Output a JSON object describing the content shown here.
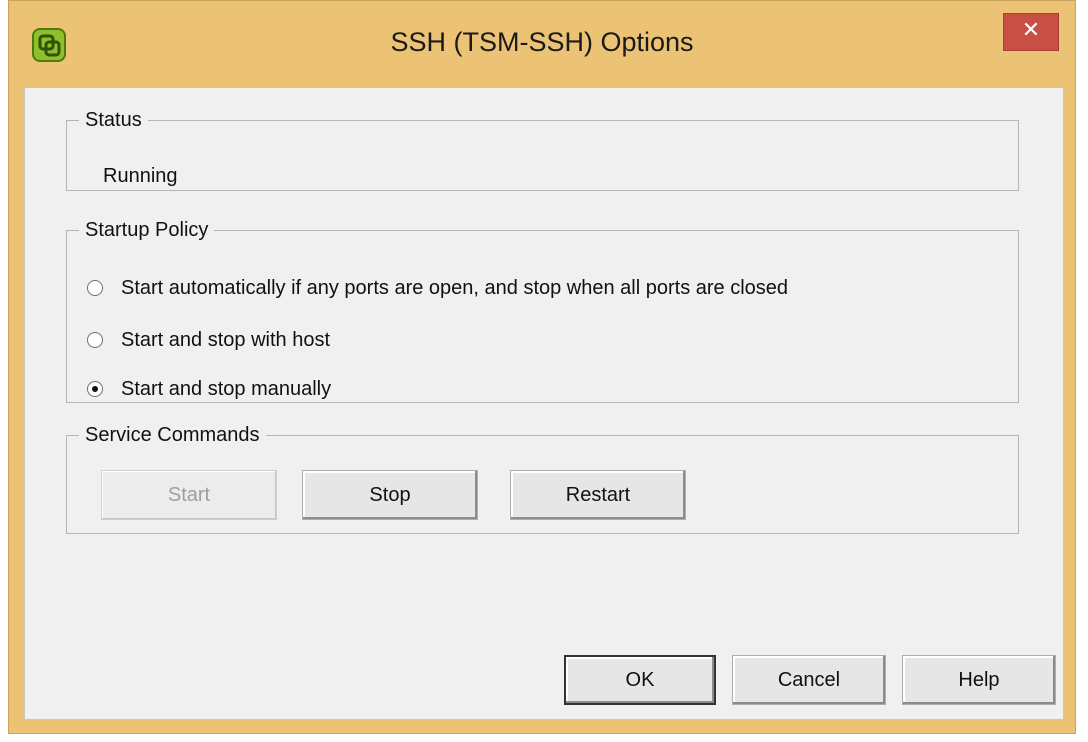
{
  "window": {
    "title": "SSH (TSM-SSH) Options",
    "close_label": "✕",
    "frame_color": "#ecc374",
    "close_color": "#c74f45"
  },
  "status": {
    "legend": "Status",
    "value": "Running"
  },
  "startup_policy": {
    "legend": "Startup Policy",
    "options": [
      {
        "label": "Start automatically if any ports are open, and stop when all ports are closed",
        "selected": false
      },
      {
        "label": "Start and stop with host",
        "selected": false
      },
      {
        "label": "Start and stop manually",
        "selected": true
      }
    ]
  },
  "service_commands": {
    "legend": "Service Commands",
    "start_label": "Start",
    "start_enabled": false,
    "stop_label": "Stop",
    "restart_label": "Restart"
  },
  "footer": {
    "ok_label": "OK",
    "cancel_label": "Cancel",
    "help_label": "Help"
  }
}
